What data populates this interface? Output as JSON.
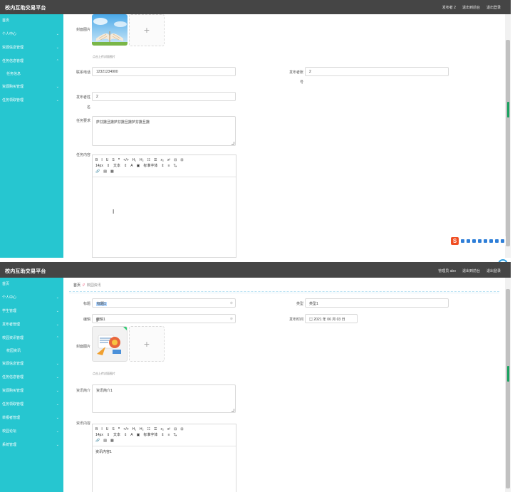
{
  "screen1": {
    "brand": "校内互助交易平台",
    "topnav": [
      "发布者 2",
      "退出到前台",
      "退出登录"
    ],
    "sidebar": [
      {
        "label": "首页",
        "chev": false
      },
      {
        "label": "个人中心",
        "chev": true
      },
      {
        "label": "资源信息管理",
        "chev": true
      },
      {
        "label": "任务信息管理",
        "chev": true,
        "sub": "任务信息"
      },
      {
        "label": "资源购买管理",
        "chev": true
      },
      {
        "label": "任务领取管理",
        "chev": true
      }
    ],
    "form": {
      "cover_label": "封面图片",
      "upload_hint": "点击上传封面图片",
      "phone_label": "联系电话",
      "phone_value": "12321234900",
      "publisher_account_label": "发布者账",
      "publisher_account_label2": "号",
      "publisher_account_value": "2",
      "publisher_name_label": "发布者姓",
      "publisher_name_label2": "名",
      "publisher_name_value": "2",
      "requirement_label": "任务要求",
      "requirement_value": "萨芬撒旦撒萨芬撒旦撒萨芬撒旦撒",
      "content_label": "任务内容"
    },
    "editor": {
      "row1": [
        "B",
        "I",
        "U",
        "S",
        "❞",
        "</>",
        "H₁",
        "H₂",
        "☷",
        "☰",
        "x₂",
        "x²",
        "⊟",
        "⊟"
      ],
      "row2": [
        "14px",
        "⇕",
        "文本",
        "⇕",
        "A",
        "▣",
        "标准字体",
        "⇕",
        "≡",
        "T̶ₓ"
      ],
      "row3": [
        "🔗",
        "▤",
        "▦"
      ]
    }
  },
  "screen2": {
    "brand": "校内互助交易平台",
    "topnav": [
      "管理员 abo",
      "退出到前台",
      "退出登录"
    ],
    "breadcrumb": {
      "home": "首页",
      "sep": "//",
      "current": "校园资讯"
    },
    "sidebar": [
      {
        "label": "首页",
        "chev": false
      },
      {
        "label": "个人中心",
        "chev": true
      },
      {
        "label": "学生管理",
        "chev": true
      },
      {
        "label": "发布者管理",
        "chev": true
      },
      {
        "label": "校园资讯管理",
        "chev": true,
        "sub": "校园资讯"
      },
      {
        "label": "资源信息管理",
        "chev": true
      },
      {
        "label": "任务信息管理",
        "chev": true
      },
      {
        "label": "资源购买管理",
        "chev": true
      },
      {
        "label": "任务领取管理",
        "chev": true
      },
      {
        "label": "举报者管理",
        "chev": true
      },
      {
        "label": "校园论坛",
        "chev": true
      },
      {
        "label": "系统管理",
        "chev": true
      }
    ],
    "form": {
      "title_label": "标题",
      "title_value": "标题1",
      "type_label": "类型",
      "type_value": "类型1",
      "edit_label": "编辑",
      "edit_value": "编辑1",
      "time_label": "发布时间",
      "time_value": "2021 年 06 月 03 日",
      "cover_label": "封面图片",
      "upload_hint": "点击上传封面图片",
      "summary_label": "资讯简介",
      "summary_value": "资讯简介1",
      "content_label": "资讯内容",
      "content_value": "资讯内容1"
    },
    "editor": {
      "row1": [
        "B",
        "I",
        "U",
        "S",
        "❞",
        "</>",
        "H₁",
        "H₂",
        "☷",
        "☰",
        "x₂",
        "x²",
        "⊟",
        "⊟"
      ],
      "row2": [
        "14px",
        "⇕",
        "文本",
        "⇕",
        "A",
        "▣",
        "标准字体",
        "⇕",
        "≡",
        "T̶ₓ"
      ],
      "row3": [
        "🔗",
        "▤",
        "▦"
      ]
    }
  },
  "colors": {
    "sidebar": "#26c6d0",
    "topbar": "#454545",
    "scroll_mark": "#1aa260",
    "ime": "#f04e23"
  },
  "icons": [
    "plus-icon",
    "chevron-down-icon",
    "calendar-icon",
    "clear-icon",
    "sogou-ime-icon",
    "text-cursor-icon"
  ]
}
